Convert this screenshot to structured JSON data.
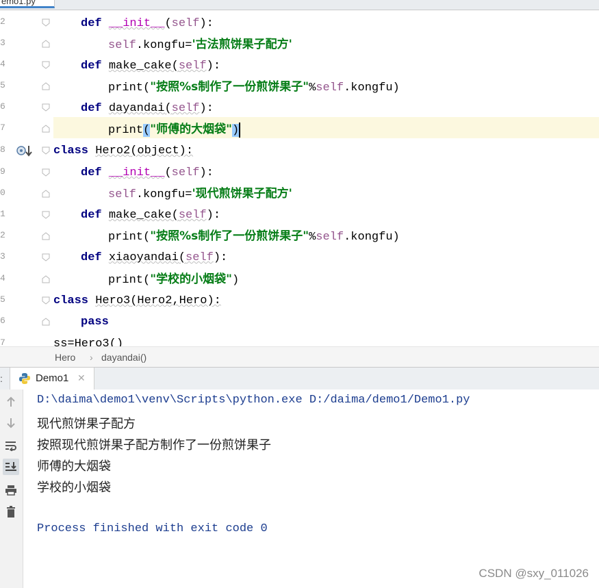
{
  "editor_tab": {
    "label": "emo1.py"
  },
  "gutter": {
    "line_numbers": [
      "2",
      "3",
      "4",
      "5",
      "6",
      "7",
      "8",
      "9",
      "0",
      "1",
      "2",
      "3",
      "4",
      "5",
      "6",
      "7"
    ]
  },
  "code": {
    "lines": [
      [
        "def ",
        "__init__",
        "(",
        "self",
        "):"
      ],
      [
        "self",
        ".kongfu=",
        "'古法煎饼果子配方'"
      ],
      [
        "def ",
        "make_cake",
        "(",
        "self",
        "):"
      ],
      [
        "print(",
        "\"按照%s制作了一份煎饼果子\"",
        "%",
        "self",
        ".kongfu)"
      ],
      [
        "def ",
        "dayandai",
        "(",
        "self",
        "):"
      ],
      [
        "print",
        "(",
        "\"师傅的大烟袋\"",
        ")"
      ],
      [
        "class ",
        "Hero2",
        "(object):"
      ],
      [
        "def ",
        "__init__",
        "(",
        "self",
        "):"
      ],
      [
        "self",
        ".kongfu=",
        "'现代煎饼果子配方'"
      ],
      [
        "def ",
        "make_cake",
        "(",
        "self",
        "):"
      ],
      [
        "print(",
        "\"按照%s制作了一份煎饼果子\"",
        "%",
        "self",
        ".kongfu)"
      ],
      [
        "def ",
        "xiaoyandai",
        "(",
        "self",
        "):"
      ],
      [
        "print(",
        "\"学校的小烟袋\"",
        ")"
      ],
      [
        "class ",
        "Hero3",
        "(Hero2,Hero):"
      ],
      [
        "pass"
      ],
      [
        "ss=Hero3()"
      ]
    ]
  },
  "breadcrumb": {
    "class_name": "Hero",
    "separator": "›",
    "method_name": "dayandai()"
  },
  "run_window": {
    "tab_label": "Demo1",
    "console": {
      "command": "D:\\daima\\demo1\\venv\\Scripts\\python.exe D:/daima/demo1/Demo1.py",
      "output": [
        "现代煎饼果子配方",
        "按照现代煎饼果子配方制作了一份煎饼果子",
        "师傅的大烟袋",
        "学校的小烟袋"
      ],
      "exit_message": "Process finished with exit code 0"
    }
  },
  "watermark": "CSDN @sxy_011026",
  "colors": {
    "keyword": "#000080",
    "self": "#94558d",
    "string": "#067d17",
    "current_line": "#fcf8df",
    "console_blue": "#1c3d8f"
  },
  "icons": [
    "python-file-icon",
    "close-icon",
    "arrow-up-icon",
    "arrow-down-icon",
    "soft-wrap-icon",
    "scroll-to-end-icon",
    "print-icon",
    "trash-icon",
    "breakpoint-override-icon",
    "fold-marker-icon"
  ]
}
